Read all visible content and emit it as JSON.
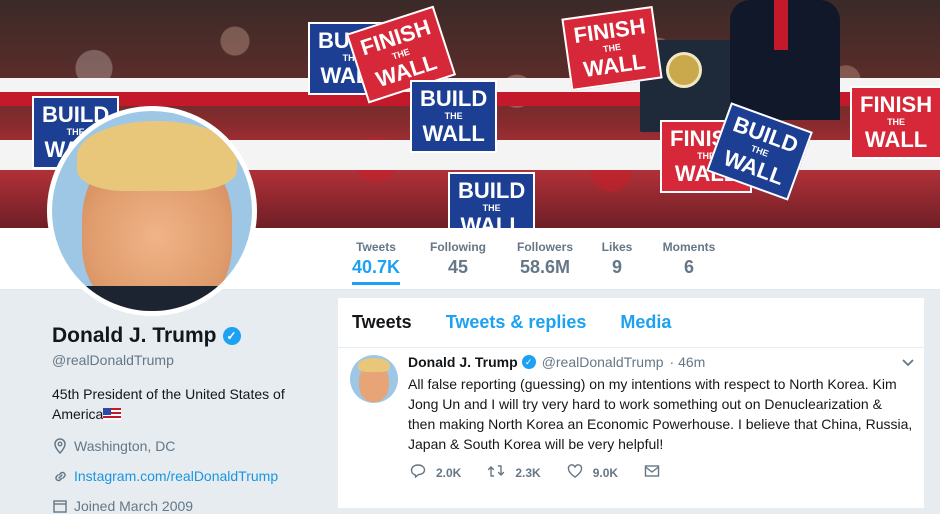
{
  "banner": {
    "signs": [
      {
        "line1": "BUILD",
        "line2": "THE",
        "line3": "WALL"
      },
      {
        "line1": "FINISH",
        "line2": "THE",
        "line3": "WALL"
      }
    ]
  },
  "stats": [
    {
      "label": "Tweets",
      "value": "40.7K"
    },
    {
      "label": "Following",
      "value": "45"
    },
    {
      "label": "Followers",
      "value": "58.6M"
    },
    {
      "label": "Likes",
      "value": "9"
    },
    {
      "label": "Moments",
      "value": "6"
    }
  ],
  "profile": {
    "name": "Donald J. Trump",
    "handle": "@realDonaldTrump",
    "bio": "45th President of the United States of America",
    "location": "Washington, DC",
    "link": "Instagram.com/realDonaldTrump",
    "joined": "Joined March 2009"
  },
  "timeline": {
    "tabs": [
      "Tweets",
      "Tweets & replies",
      "Media"
    ],
    "tweet": {
      "name": "Donald J. Trump",
      "handle": "@realDonaldTrump",
      "time": "· 46m",
      "text": "All false reporting (guessing) on my intentions with respect to North Korea. Kim Jong Un and I will try very hard to work something out on Denuclearization & then making North Korea an Economic Powerhouse. I believe that China, Russia, Japan & South Korea will be very helpful!",
      "replies": "2.0K",
      "retweets": "2.3K",
      "likes": "9.0K"
    }
  },
  "colors": {
    "accent": "#1da1f2",
    "text": "#14171a",
    "muted": "#657786"
  }
}
